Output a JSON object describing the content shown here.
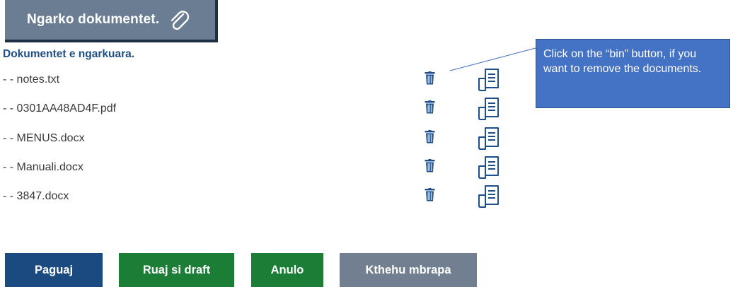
{
  "upload": {
    "label": "Ngarko dokumentet.",
    "icon": "paperclip-icon"
  },
  "uploaded_title": "Dokumentet e ngarkuara.",
  "files": [
    {
      "name": "- - notes.txt"
    },
    {
      "name": "- - 0301AA48AD4F.pdf"
    },
    {
      "name": "- - MENUS.docx"
    },
    {
      "name": "- - Manuali.docx"
    },
    {
      "name": "- - 3847.docx"
    }
  ],
  "row_icons": {
    "delete": "bin-icon",
    "view": "document-view-icon"
  },
  "callout": {
    "text": "Click on the “bin” button, if you want to remove the documents."
  },
  "actions": {
    "pay": "Paguaj",
    "save_draft": "Ruaj si draft",
    "cancel": "Anulo",
    "back": "Kthehu mbrapa"
  },
  "colors": {
    "upload_bg": "#6b7d92",
    "title_blue": "#1d4f87",
    "pay_bg": "#1a4a7f",
    "green_bg": "#1b7d36",
    "back_bg": "#717f91",
    "callout_bg": "#4472c4",
    "icon_blue": "#1f4e8c"
  }
}
